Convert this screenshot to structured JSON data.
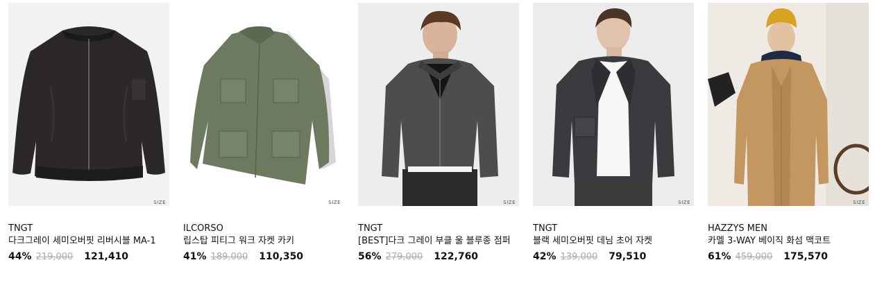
{
  "size_label": "SIZE",
  "products": [
    {
      "brand": "TNGT",
      "name": "다크그레이 세미오버핏 리버시블 MA-1",
      "discount": "44%",
      "original_price": "219,000",
      "price": "121,410",
      "image": "dark-bomber-jacket-photo"
    },
    {
      "brand": "ILCORSO",
      "name": "립스탑 피티그 워크 자켓 카키",
      "discount": "41%",
      "original_price": "189,000",
      "price": "110,350",
      "image": "khaki-work-jacket-photo"
    },
    {
      "brand": "TNGT",
      "name": "[BEST]다크 그레이 부클 울 블루종 점퍼",
      "discount": "56%",
      "original_price": "279,000",
      "price": "122,760",
      "image": "model-grey-boucle-blouson-photo"
    },
    {
      "brand": "TNGT",
      "name": "블랙 세미오버핏 데님 초어 자켓",
      "discount": "42%",
      "original_price": "139,000",
      "price": "79,510",
      "image": "model-black-denim-jacket-photo"
    },
    {
      "brand": "HAZZYS MEN",
      "name": "카멜 3-WAY 베이직 화섬 맥코트",
      "discount": "61%",
      "original_price": "459,000",
      "price": "175,570",
      "image": "model-camel-mac-coat-photo"
    }
  ]
}
